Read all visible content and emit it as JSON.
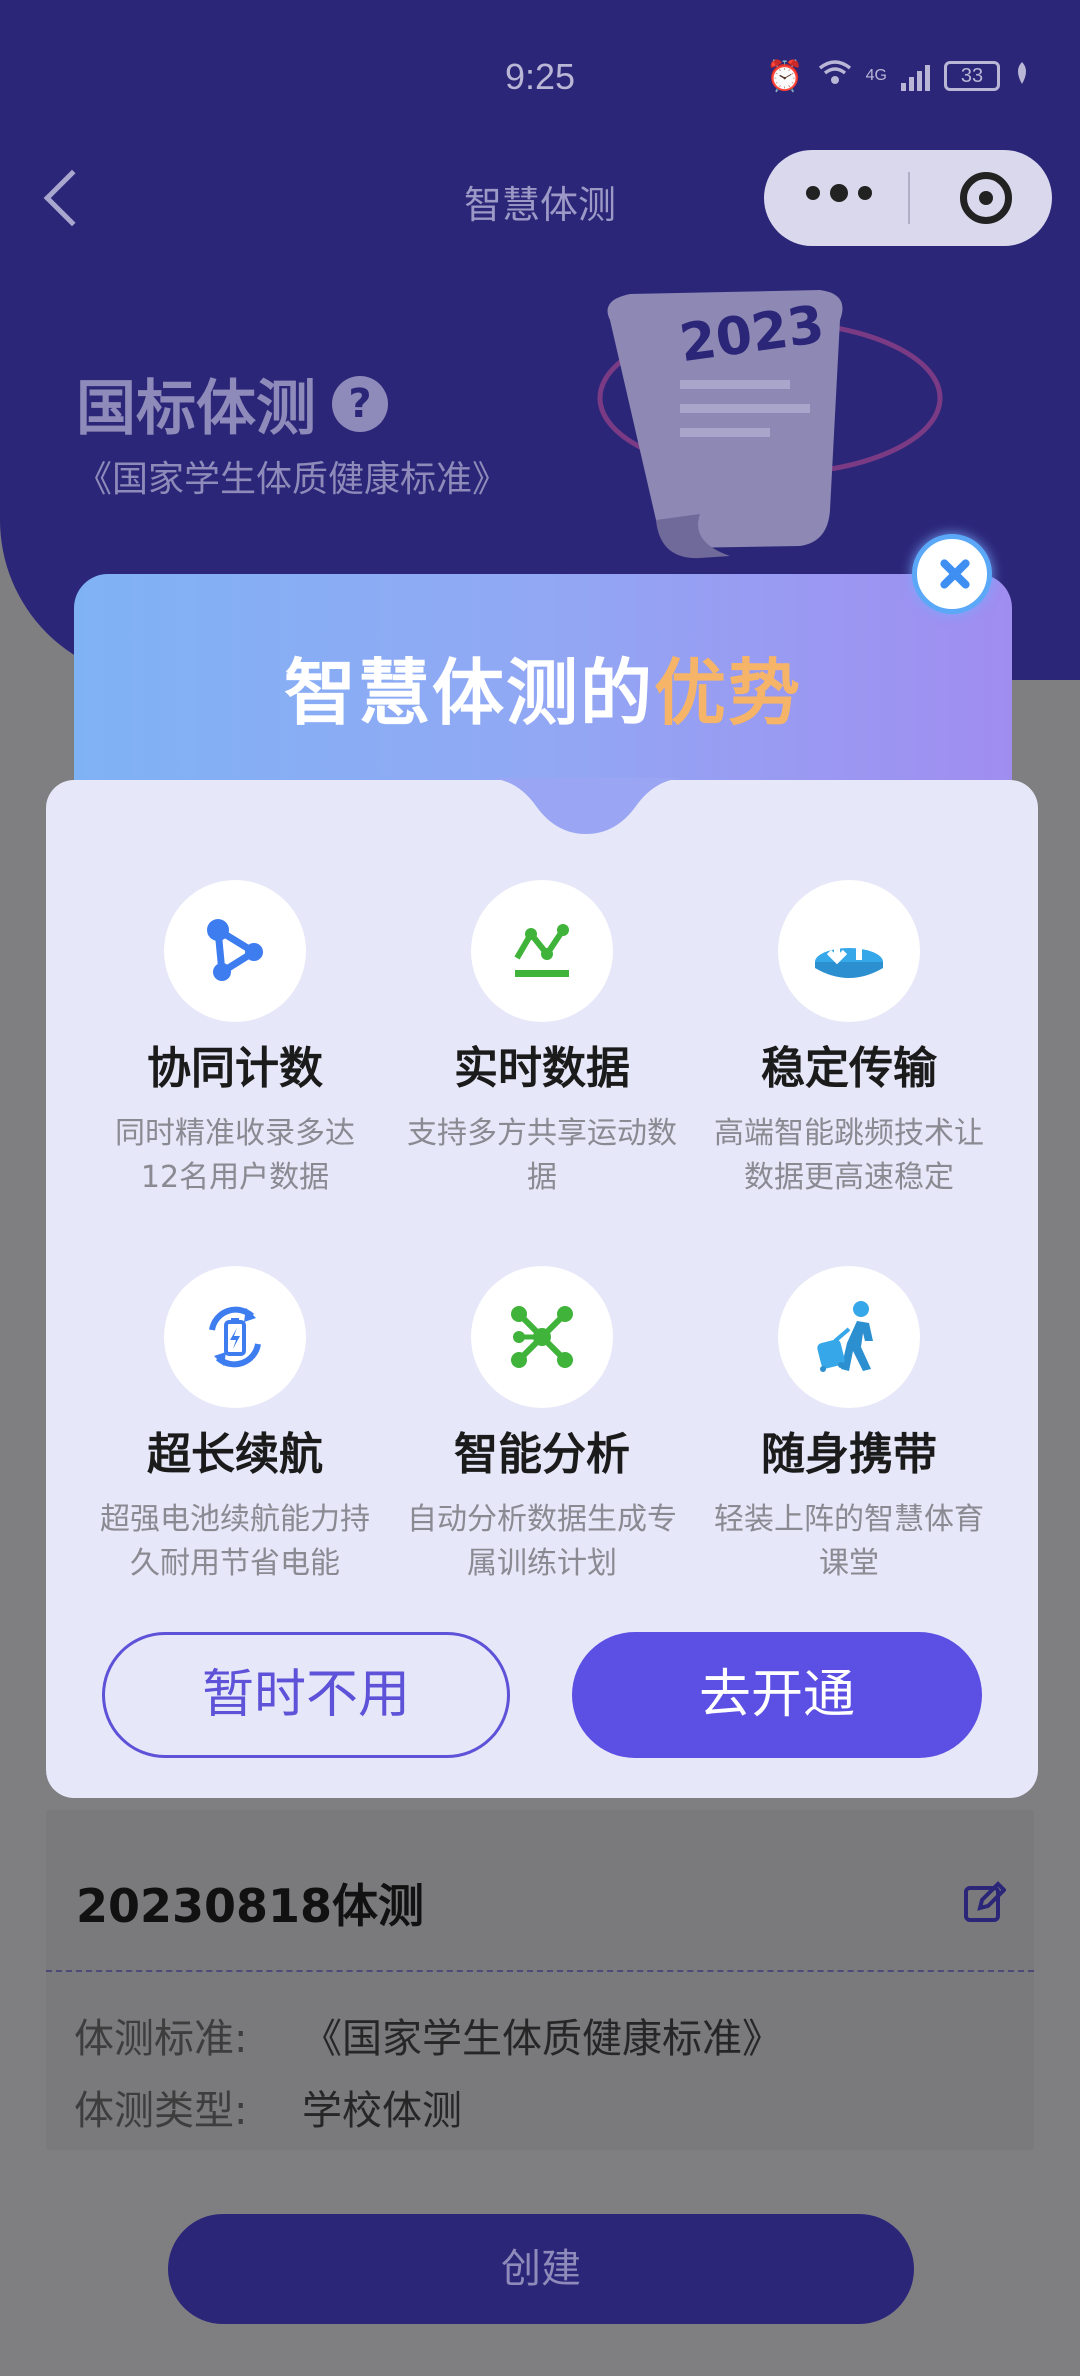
{
  "status_bar": {
    "time": "9:25",
    "network": "4G",
    "battery": "33"
  },
  "nav": {
    "title": "智慧体测"
  },
  "hero": {
    "title": "国标体测",
    "help": "?",
    "subtitle": "《国家学生体质健康标准》",
    "art_year": "2023"
  },
  "modal": {
    "title_main": "智慧体测的",
    "title_accent": "优势",
    "features": [
      {
        "icon": "share-icon",
        "title": "协同计数",
        "desc": "同时精准收录多达12名用户数据"
      },
      {
        "icon": "chart-line-icon",
        "title": "实时数据",
        "desc": "支持多方共享运动数据"
      },
      {
        "icon": "transfer-icon",
        "title": "稳定传输",
        "desc": "高端智能跳频技术让数据更高速稳定"
      },
      {
        "icon": "battery-icon",
        "title": "超长续航",
        "desc": "超强电池续航能力持久耐用节省电能"
      },
      {
        "icon": "network-icon",
        "title": "智能分析",
        "desc": "自动分析数据生成专属训练计划"
      },
      {
        "icon": "traveler-icon",
        "title": "随身携带",
        "desc": "轻装上阵的智慧体育课堂"
      }
    ],
    "later_label": "暂时不用",
    "open_label": "去开通"
  },
  "record": {
    "title": "20230818体测",
    "standard_key": "体测标准:",
    "standard_value": "《国家学生体质健康标准》",
    "type_key": "体测类型:",
    "type_value": "学校体测"
  },
  "create_label": "创建",
  "colors": {
    "primary": "#5c4fe4",
    "header": "#2c2678",
    "accent": "#f5b467",
    "icon_blue": "#3d7df0",
    "icon_green": "#3fb33a"
  }
}
